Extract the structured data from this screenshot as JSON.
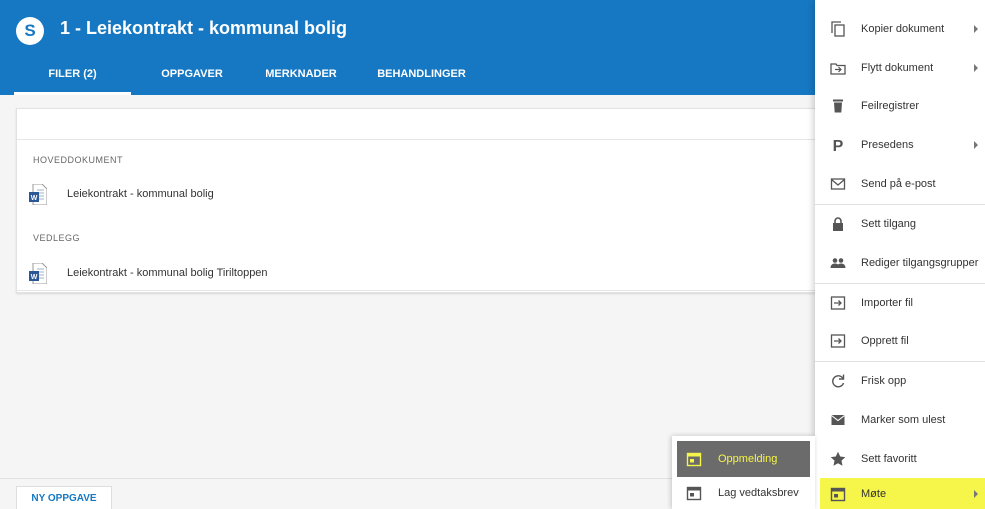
{
  "header": {
    "logo": "S",
    "title": "1 - Leiekontrakt - kommunal bolig",
    "tabs": [
      {
        "label": "FILER (2)",
        "active": true
      },
      {
        "label": "OPPGAVER",
        "active": false
      },
      {
        "label": "MERKNADER",
        "active": false
      },
      {
        "label": "BEHANDLINGER",
        "active": false
      }
    ]
  },
  "files": {
    "main_label": "HOVEDDOKUMENT",
    "main_file": "Leiekontrakt - kommunal bolig",
    "attachments_label": "VEDLEGG",
    "attachment_file": "Leiekontrakt - kommunal bolig Tiriltoppen"
  },
  "bottom": {
    "new_task_label": "NY OPPGAVE"
  },
  "menu": {
    "items": [
      {
        "label": "Kopier dokument",
        "icon": "copy-icon",
        "submenu": true
      },
      {
        "label": "Flytt dokument",
        "icon": "move-folder-icon",
        "submenu": true
      },
      {
        "label": "Feilregistrer",
        "icon": "trash-icon",
        "submenu": false
      },
      {
        "label": "Presedens",
        "icon": "p-letter-icon",
        "submenu": true
      },
      {
        "label": "Send på e-post",
        "icon": "email-icon",
        "submenu": false
      },
      {
        "label": "Sett tilgang",
        "icon": "lock-icon",
        "submenu": false
      },
      {
        "label": "Rediger tilgangsgrupper",
        "icon": "group-icon",
        "submenu": false
      },
      {
        "label": "Importer fil",
        "icon": "import-icon",
        "submenu": false
      },
      {
        "label": "Opprett fil",
        "icon": "create-file-icon",
        "submenu": false
      },
      {
        "label": "Frisk opp",
        "icon": "refresh-icon",
        "submenu": false
      },
      {
        "label": "Marker som ulest",
        "icon": "envelope-filled-icon",
        "submenu": false
      },
      {
        "label": "Sett favoritt",
        "icon": "star-icon",
        "submenu": false
      },
      {
        "label": "Møte",
        "icon": "calendar-icon",
        "submenu": true
      }
    ]
  },
  "submenu": {
    "items": [
      {
        "label": "Oppmelding",
        "icon": "calendar-icon",
        "selected": true
      },
      {
        "label": "Lag vedtaksbrev",
        "icon": "calendar-icon",
        "selected": false
      }
    ]
  },
  "colors": {
    "brand_blue": "#1678c2",
    "highlight_yellow": "#f5f54a",
    "selected_gray": "#6b6b6b"
  }
}
